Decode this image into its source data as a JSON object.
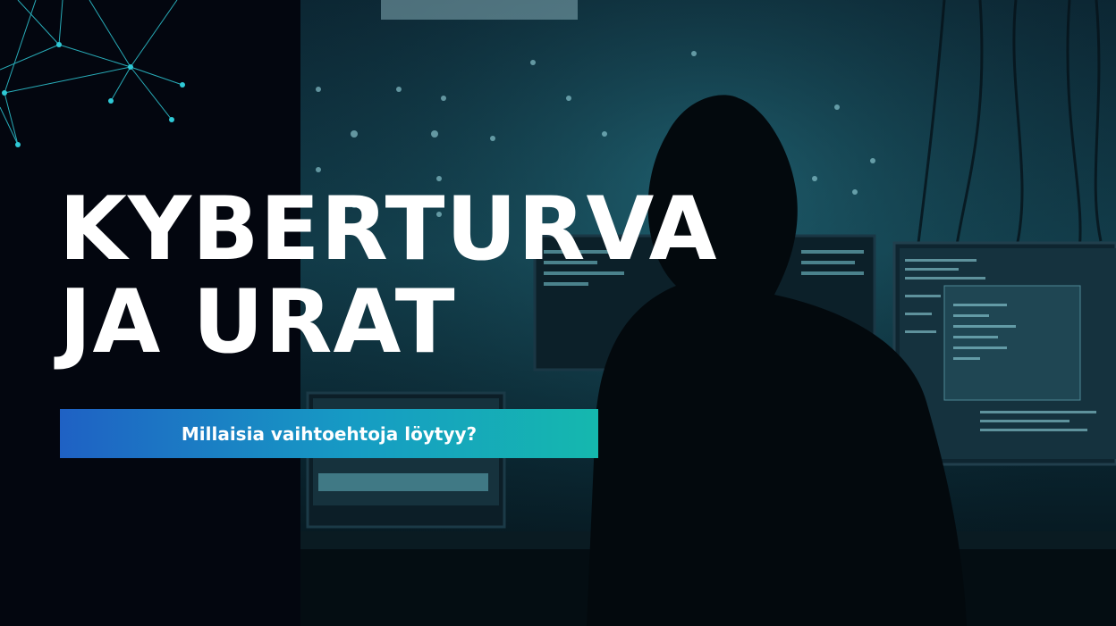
{
  "title": {
    "line1": "KYBERTURVA",
    "line2": "JA URAT"
  },
  "subtitle": "Millaisia vaihtoehtoja löytyy?",
  "colors": {
    "background": "#03060f",
    "title_text": "#ffffff",
    "banner_start": "#1f61c4",
    "banner_end": "#15b8ae",
    "network_lines": "#2fc9d6"
  },
  "decorations": {
    "network_graphic": "network-node-graph",
    "photo": "hooded-hacker-at-computer-monitors"
  }
}
